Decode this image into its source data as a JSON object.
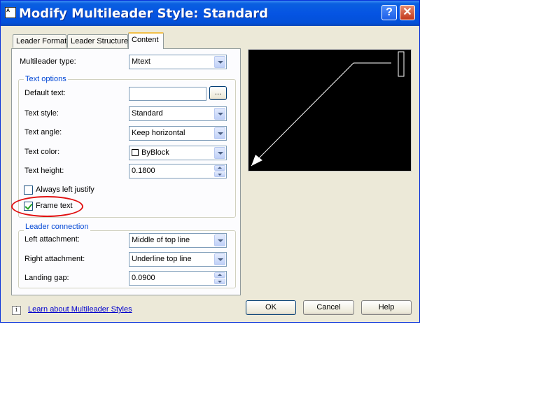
{
  "window": {
    "title": "Modify Multileader Style: Standard",
    "help_glyph": "?",
    "close_glyph": "✕",
    "app_icon_text": "A"
  },
  "tabs": [
    {
      "label": "Leader Format"
    },
    {
      "label": "Leader Structure"
    },
    {
      "label": "Content"
    }
  ],
  "content": {
    "multileader_type": {
      "label": "Multileader type:",
      "value": "Mtext"
    },
    "text_options": {
      "group_title": "Text options",
      "default_text": {
        "label": "Default text:",
        "value": "",
        "browse_label": "..."
      },
      "text_style": {
        "label": "Text style:",
        "value": "Standard"
      },
      "text_angle": {
        "label": "Text angle:",
        "value": "Keep horizontal"
      },
      "text_color": {
        "label": "Text color:",
        "value": "ByBlock"
      },
      "text_height": {
        "label": "Text height:",
        "value": "0.1800"
      },
      "always_left_justify": {
        "label": "Always left justify",
        "checked": false
      },
      "frame_text": {
        "label": "Frame text",
        "checked": true
      }
    },
    "leader_connection": {
      "group_title": "Leader connection",
      "left_attachment": {
        "label": "Left attachment:",
        "value": "Middle of top line"
      },
      "right_attachment": {
        "label": "Right attachment:",
        "value": "Underline top line"
      },
      "landing_gap": {
        "label": "Landing gap:",
        "value": "0.0900"
      }
    }
  },
  "footer": {
    "link_text": "Learn about Multileader Styles",
    "info_glyph": "i",
    "ok_label": "OK",
    "cancel_label": "Cancel",
    "help_label": "Help"
  },
  "colors": {
    "titlebar": "#0554e3",
    "annotation_circle": "#e01010",
    "preview_background": "#000000",
    "preview_lines": "#ffffff"
  }
}
